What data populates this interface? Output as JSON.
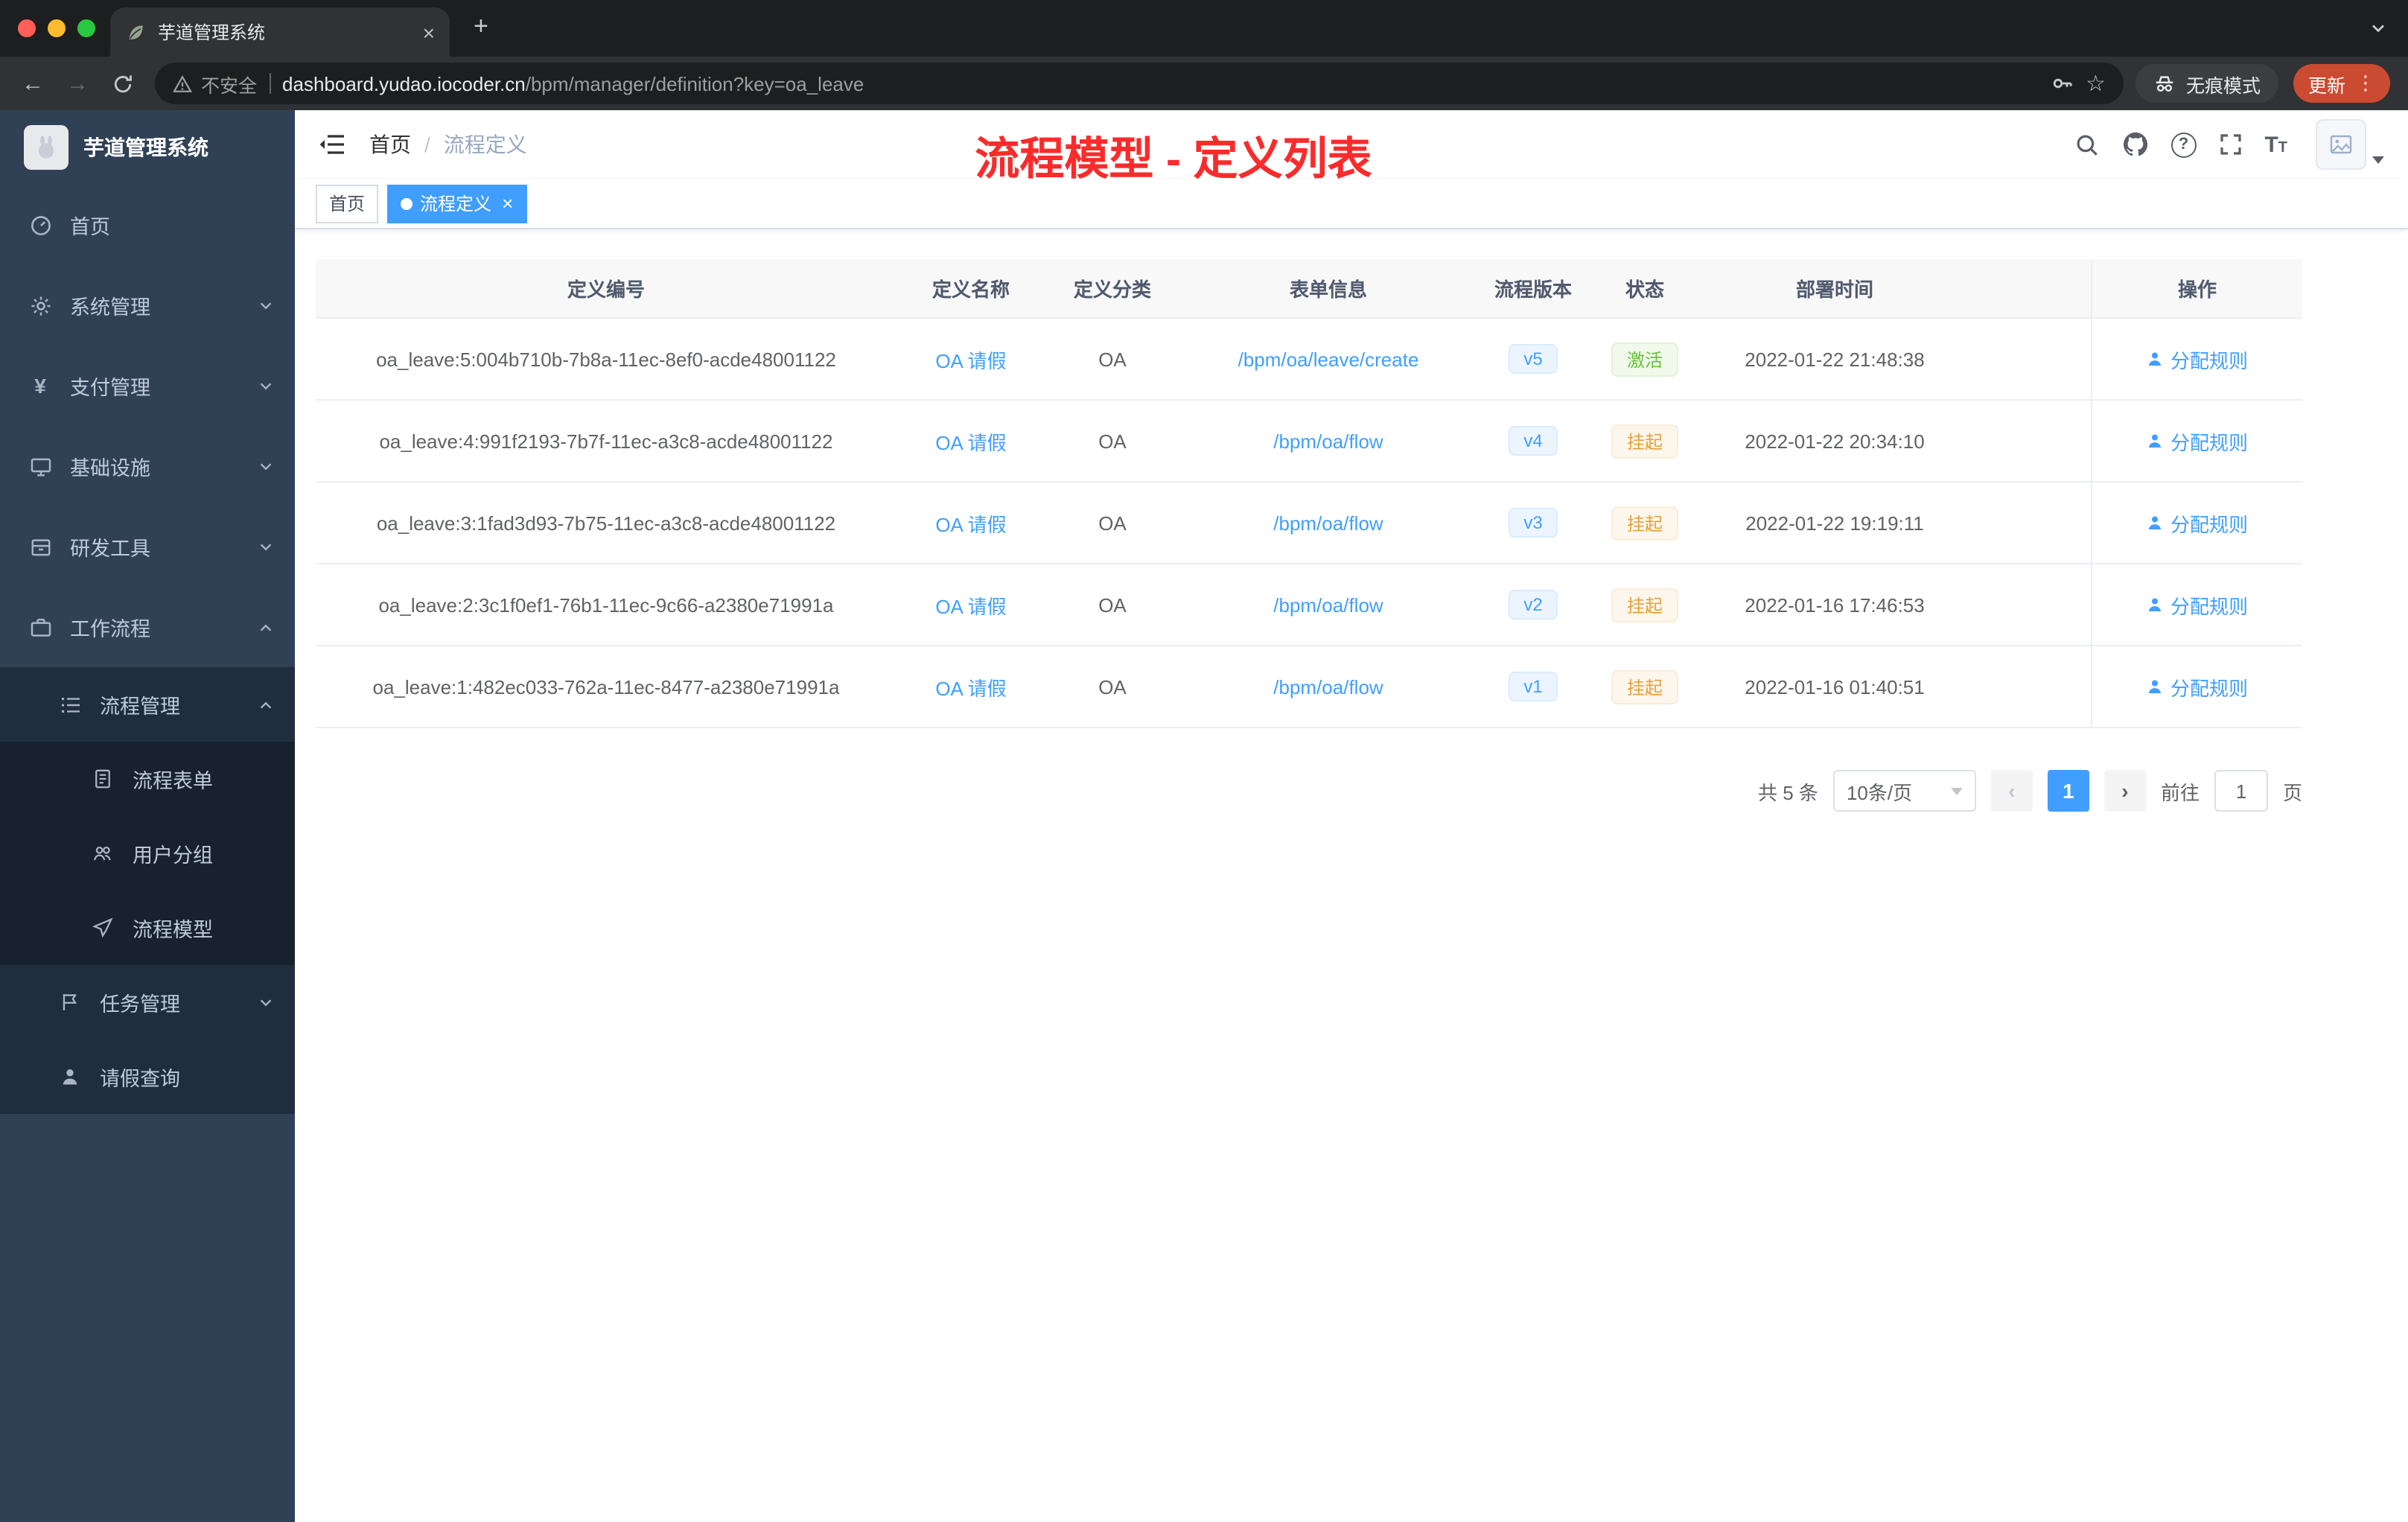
{
  "browser": {
    "tab_title": "芋道管理系统",
    "security_label": "不安全",
    "url_host": "dashboard.yudao.iocoder.cn",
    "url_path": "/bpm/manager/definition?key=oa_leave",
    "incognito_label": "无痕模式",
    "update_label": "更新"
  },
  "sidebar": {
    "logo_title": "芋道管理系统",
    "items": [
      {
        "label": "首页",
        "icon": "dashboard-icon"
      },
      {
        "label": "系统管理",
        "icon": "gear-icon"
      },
      {
        "label": "支付管理",
        "icon": "yen-icon"
      },
      {
        "label": "基础设施",
        "icon": "monitor-icon"
      },
      {
        "label": "研发工具",
        "icon": "toolbox-icon"
      },
      {
        "label": "工作流程",
        "icon": "briefcase-icon"
      },
      {
        "label": "流程管理",
        "icon": "list-icon"
      },
      {
        "label": "流程表单",
        "icon": "form-icon"
      },
      {
        "label": "用户分组",
        "icon": "users-icon"
      },
      {
        "label": "流程模型",
        "icon": "paper-plane-icon"
      },
      {
        "label": "任务管理",
        "icon": "flag-icon"
      },
      {
        "label": "请假查询",
        "icon": "person-icon"
      }
    ]
  },
  "header": {
    "breadcrumb_home": "首页",
    "breadcrumb_sep": "/",
    "breadcrumb_current": "流程定义",
    "annotation": "流程模型 - 定义列表"
  },
  "tags": {
    "home": "首页",
    "active": "流程定义"
  },
  "table": {
    "columns": [
      {
        "label": "定义编号"
      },
      {
        "label": "定义名称"
      },
      {
        "label": "定义分类"
      },
      {
        "label": "表单信息"
      },
      {
        "label": "流程版本"
      },
      {
        "label": "状态"
      },
      {
        "label": "部署时间"
      },
      {
        "label": "操作"
      }
    ],
    "rows": [
      {
        "id": "oa_leave:5:004b710b-7b8a-11ec-8ef0-acde48001122",
        "name": "OA 请假",
        "category": "OA",
        "form": "/bpm/oa/leave/create",
        "version": "v5",
        "status": "激活",
        "status_type": "success",
        "deploy_time": "2022-01-22 21:48:38",
        "action": "分配规则"
      },
      {
        "id": "oa_leave:4:991f2193-7b7f-11ec-a3c8-acde48001122",
        "name": "OA 请假",
        "category": "OA",
        "form": "/bpm/oa/flow",
        "version": "v4",
        "status": "挂起",
        "status_type": "warning",
        "deploy_time": "2022-01-22 20:34:10",
        "action": "分配规则"
      },
      {
        "id": "oa_leave:3:1fad3d93-7b75-11ec-a3c8-acde48001122",
        "name": "OA 请假",
        "category": "OA",
        "form": "/bpm/oa/flow",
        "version": "v3",
        "status": "挂起",
        "status_type": "warning",
        "deploy_time": "2022-01-22 19:19:11",
        "action": "分配规则"
      },
      {
        "id": "oa_leave:2:3c1f0ef1-76b1-11ec-9c66-a2380e71991a",
        "name": "OA 请假",
        "category": "OA",
        "form": "/bpm/oa/flow",
        "version": "v2",
        "status": "挂起",
        "status_type": "warning",
        "deploy_time": "2022-01-16 17:46:53",
        "action": "分配规则"
      },
      {
        "id": "oa_leave:1:482ec033-762a-11ec-8477-a2380e71991a",
        "name": "OA 请假",
        "category": "OA",
        "form": "/bpm/oa/flow",
        "version": "v1",
        "status": "挂起",
        "status_type": "warning",
        "deploy_time": "2022-01-16 01:40:51",
        "action": "分配规则"
      }
    ]
  },
  "pagination": {
    "total": "共 5 条",
    "size": "10条/页",
    "page": "1",
    "goto_label": "前往",
    "goto_value": "1",
    "unit": "页"
  }
}
